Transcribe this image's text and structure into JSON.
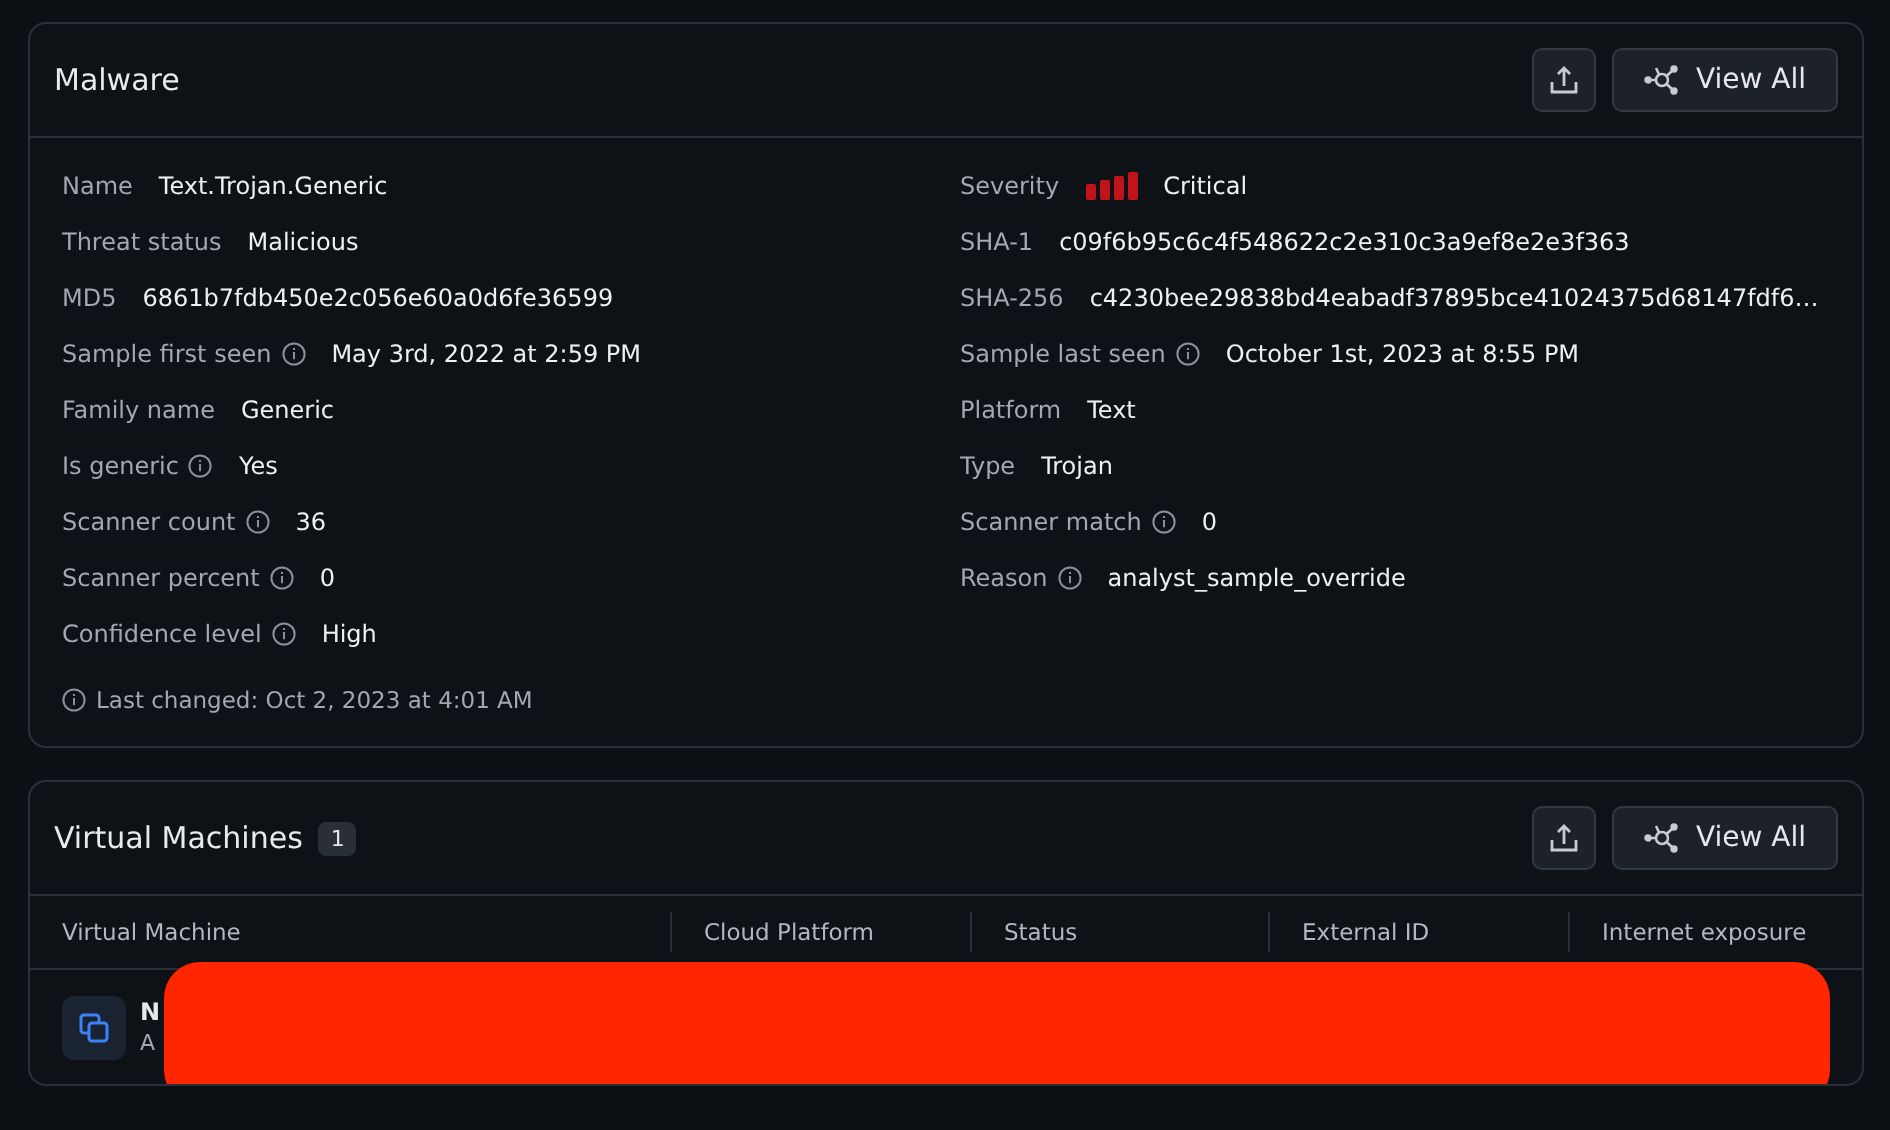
{
  "malware": {
    "title": "Malware",
    "view_all": "View All",
    "left": [
      {
        "label": "Name",
        "info": false,
        "value": "Text.Trojan.Generic"
      },
      {
        "label": "Threat status",
        "info": false,
        "value": "Malicious"
      },
      {
        "label": "MD5",
        "info": false,
        "value": "6861b7fdb450e2c056e60a0d6fe36599"
      },
      {
        "label": "Sample first seen",
        "info": true,
        "value": "May 3rd, 2022 at 2:59 PM"
      },
      {
        "label": "Family name",
        "info": false,
        "value": "Generic"
      },
      {
        "label": "Is generic",
        "info": true,
        "value": "Yes"
      },
      {
        "label": "Scanner count",
        "info": true,
        "value": "36"
      },
      {
        "label": "Scanner percent",
        "info": true,
        "value": "0"
      },
      {
        "label": "Confidence level",
        "info": true,
        "value": "High"
      }
    ],
    "right": [
      {
        "label": "Severity",
        "info": false,
        "kind": "severity",
        "value": "Critical"
      },
      {
        "label": "SHA-1",
        "info": false,
        "kind": "text",
        "value": "c09f6b95c6c4f548622c2e310c3a9ef8e2e3f363"
      },
      {
        "label": "SHA-256",
        "info": false,
        "kind": "text",
        "value": "c4230bee29838bd4eabadf37895bce41024375d68147fdf6…"
      },
      {
        "label": "Sample last seen",
        "info": true,
        "kind": "text",
        "value": "October 1st, 2023 at 8:55 PM"
      },
      {
        "label": "Platform",
        "info": false,
        "kind": "text",
        "value": "Text"
      },
      {
        "label": "Type",
        "info": false,
        "kind": "text",
        "value": "Trojan"
      },
      {
        "label": "Scanner match",
        "info": true,
        "kind": "text",
        "value": "0"
      },
      {
        "label": "Reason",
        "info": true,
        "kind": "text",
        "value": "analyst_sample_override"
      }
    ],
    "last_changed": "Last changed: Oct 2, 2023 at 4:01 AM"
  },
  "virtual_machines": {
    "title": "Virtual Machines",
    "count": "1",
    "view_all": "View All",
    "table": {
      "columns": [
        "Virtual Machine",
        "Cloud Platform",
        "Status",
        "External ID",
        "Internet exposure"
      ],
      "rows": [
        {
          "name": "N",
          "subtitle": "A",
          "redacted": true
        }
      ]
    }
  }
}
